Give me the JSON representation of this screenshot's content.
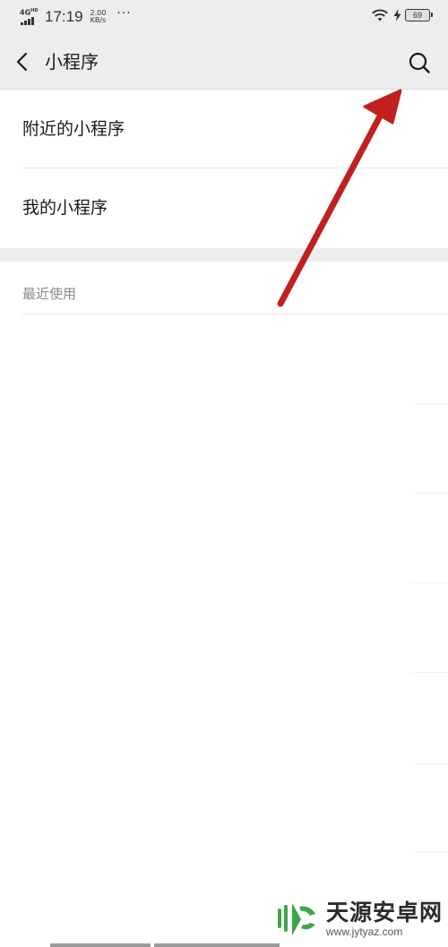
{
  "status_bar": {
    "network_type": "4G",
    "network_hd": "HD",
    "time": "17:19",
    "speed_value": "2.00",
    "speed_unit": "KB/s",
    "more": "···",
    "battery_level": "69"
  },
  "nav": {
    "back_icon": "chevron-left-icon",
    "title": "小程序",
    "search_icon": "search-icon"
  },
  "menu": {
    "items": [
      {
        "label": "附近的小程序"
      },
      {
        "label": "我的小程序"
      }
    ]
  },
  "recent": {
    "header": "最近使用"
  },
  "annotation": {
    "color": "#c0201e",
    "target": "search-button"
  },
  "watermark": {
    "name": "天源安卓网",
    "url": "www.jytyaz.com",
    "logo_color": "#3ea64a"
  }
}
